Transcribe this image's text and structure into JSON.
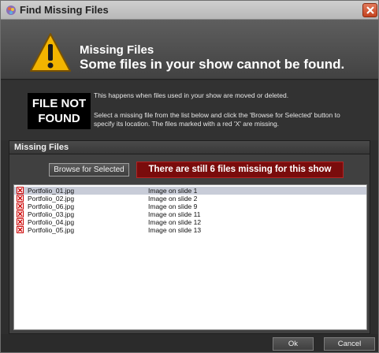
{
  "window": {
    "title": "Find Missing Files"
  },
  "header": {
    "title": "Missing Files",
    "subtitle": "Some files in your show cannot be found."
  },
  "info": {
    "badge_line1": "FILE NOT",
    "badge_line2": "FOUND",
    "text1": "This happens when files used in your show are moved or deleted.",
    "text2": "Select a missing file from the list below and click the 'Browse for Selected' button to specify its location. The files marked with a red 'X' are missing."
  },
  "panel": {
    "title": "Missing Files",
    "browse_label": "Browse for Selected",
    "status": "There are still 6 files missing for this show"
  },
  "files": [
    {
      "name": "Portfolio_01.jpg",
      "location": "Image on slide 1"
    },
    {
      "name": "Portfolio_02.jpg",
      "location": "Image on slide 2"
    },
    {
      "name": "Portfolio_06.jpg",
      "location": "Image on slide 9"
    },
    {
      "name": "Portfolio_03.jpg",
      "location": "Image on slide 11"
    },
    {
      "name": "Portfolio_04.jpg",
      "location": "Image on slide 12"
    },
    {
      "name": "Portfolio_05.jpg",
      "location": "Image on slide 13"
    }
  ],
  "footer": {
    "ok_label": "Ok",
    "cancel_label": "Cancel"
  },
  "colors": {
    "status_bg": "#7a0c0c",
    "missing_x": "#cc0000",
    "selected_row": "#c8ccd8"
  },
  "icons": {
    "app": "app-icon",
    "close": "close-icon",
    "warning": "warning-icon",
    "missing": "missing-x-icon"
  }
}
